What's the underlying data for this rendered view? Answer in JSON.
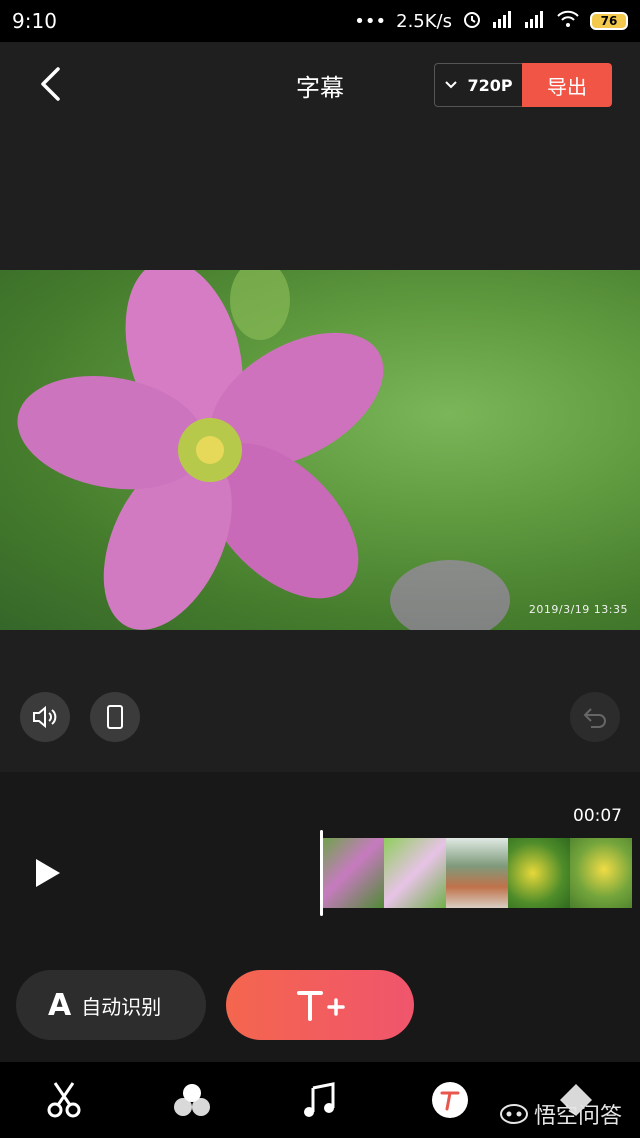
{
  "status_bar": {
    "time": "9:10",
    "dots": "•••",
    "speed": "2.5K/s",
    "battery": "76"
  },
  "header": {
    "title": "字幕",
    "resolution": "720P",
    "export_label": "导出"
  },
  "preview": {
    "timestamp": "2019/3/19  13:35"
  },
  "timeline": {
    "duration": "00:07"
  },
  "actions": {
    "auto_a": "A",
    "auto_recognize_label": "自动识别"
  },
  "bottom_nav": {
    "items": [
      {
        "icon": "scissors-icon"
      },
      {
        "icon": "filter-icon"
      },
      {
        "icon": "music-note-icon"
      },
      {
        "icon": "text-icon"
      },
      {
        "icon": "sticker-icon"
      }
    ]
  },
  "watermark": {
    "text": "悟空问答"
  },
  "colors": {
    "accent": "#f05545",
    "background": "#1f1f1f",
    "timeline_bg": "#181818"
  }
}
